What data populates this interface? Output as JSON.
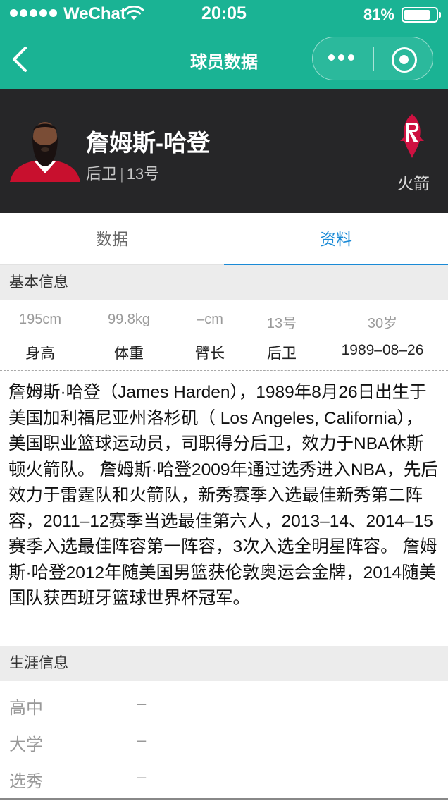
{
  "status_bar": {
    "carrier": "WeChat",
    "time": "20:05",
    "battery_percent": "81%",
    "battery_level": 0.81,
    "icons": [
      "signal-icon",
      "wifi-icon",
      "battery-icon"
    ]
  },
  "nav": {
    "title": "球员数据",
    "icons": [
      "back-arrow-icon",
      "more-dots-icon",
      "close-target-icon"
    ]
  },
  "player": {
    "name": "詹姆斯-哈登",
    "position": "后卫",
    "number": "13号",
    "team": "火箭",
    "colors": {
      "header_bg": "#262628",
      "nav_bg": "#1ab394",
      "team_red": "#ce1141"
    }
  },
  "tabs": [
    {
      "label": "数据",
      "active": false
    },
    {
      "label": "资料",
      "active": true
    }
  ],
  "accent_color": "#1a8ad6",
  "basic_info": {
    "title": "基本信息",
    "stats": [
      {
        "value": "195cm",
        "label": "身高"
      },
      {
        "value": "99.8kg",
        "label": "体重"
      },
      {
        "value": "–cm",
        "label": "臂长"
      },
      {
        "value": "13号",
        "label": "后卫"
      },
      {
        "value": "30岁",
        "label": "1989–08–26"
      }
    ],
    "bio": "詹姆斯·哈登（James Harden），1989年8月26日出生于美国加利福尼亚州洛杉矶（ Los Angeles, California），美国职业篮球运动员，司职得分后卫，效力于NBA休斯顿火箭队。 詹姆斯·哈登2009年通过选秀进入NBA，先后效力于雷霆队和火箭队，新秀赛季入选最佳新秀第二阵容，2011–12赛季当选最佳第六人，2013–14、2014–15赛季入选最佳阵容第一阵容，3次入选全明星阵容。 詹姆斯·哈登2012年随美国男篮获伦敦奥运会金牌，2014随美国队获西班牙篮球世界杯冠军。"
  },
  "career_info": {
    "title": "生涯信息",
    "rows": [
      {
        "label": "高中",
        "value": "–"
      },
      {
        "label": "大学",
        "value": "–"
      },
      {
        "label": "选秀",
        "value": "–"
      }
    ]
  }
}
